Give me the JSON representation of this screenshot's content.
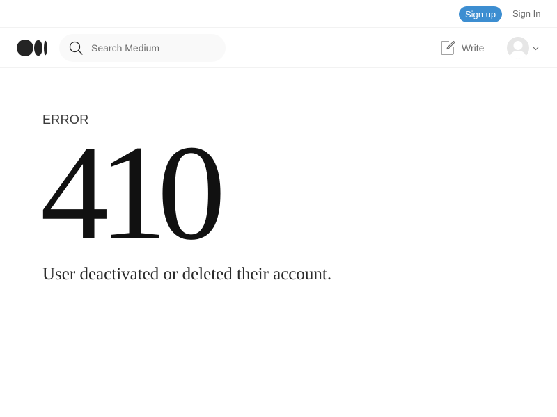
{
  "topbar": {
    "signup_label": "Sign up",
    "signin_label": "Sign In",
    "signup_color": "#3d8ed1"
  },
  "navbar": {
    "logo_icon": "medium-logo-icon",
    "search": {
      "icon": "search-icon",
      "placeholder": "Search Medium",
      "value": ""
    },
    "write": {
      "icon": "edit-icon",
      "label": "Write"
    },
    "profile": {
      "avatar_icon": "avatar-placeholder-icon",
      "chevron_icon": "chevron-down-icon"
    }
  },
  "main": {
    "error_label": "ERROR",
    "error_code": "410",
    "message": "User deactivated or deleted their account."
  }
}
